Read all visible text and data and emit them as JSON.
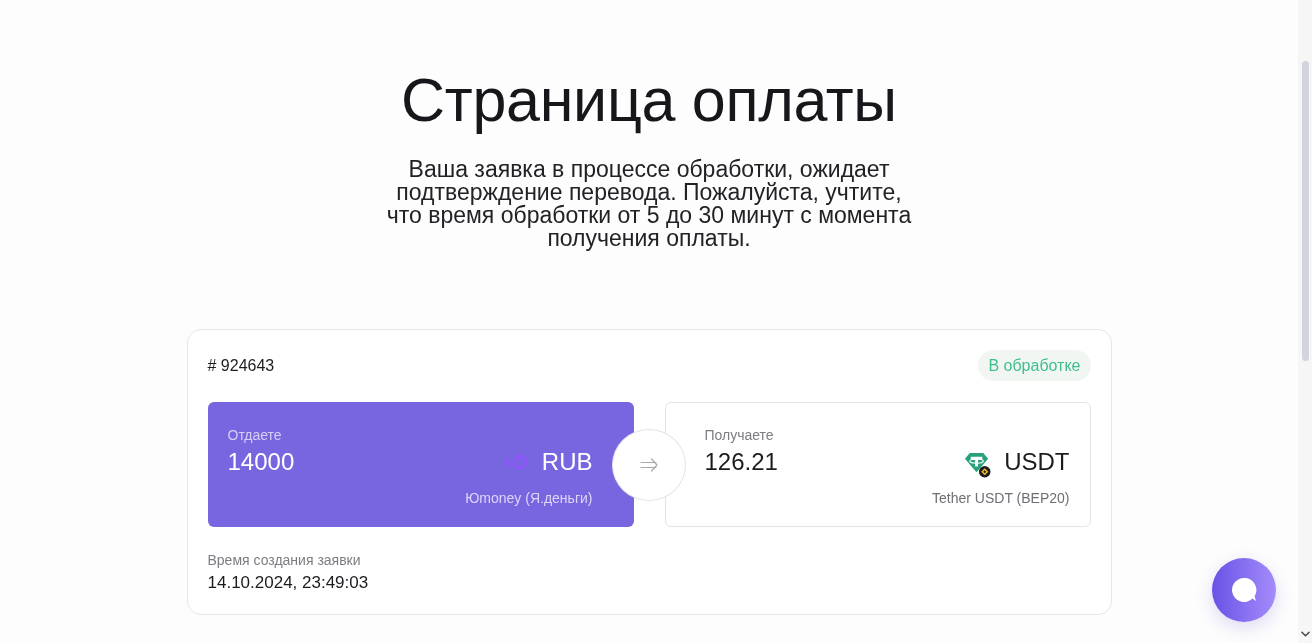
{
  "page": {
    "title": "Страница оплаты",
    "description": "Ваша заявка в процессе обработки, ожидает подтверждение перевода. Пожалуйста, учтите, что время обработки от 5 до 30 минут с момента получения оплаты."
  },
  "order": {
    "number": "# 924643",
    "status": {
      "label": "В обработке",
      "kind": "processing"
    }
  },
  "exchange": {
    "give": {
      "label": "Отдаете",
      "amount": "14000",
      "currency": "RUB",
      "method": "Юmoney (Я.деньги)"
    },
    "receive": {
      "label": "Получаете",
      "amount": "126.21",
      "currency": "USDT",
      "method": "Tether USDT (BEP20)"
    }
  },
  "created": {
    "label": "Время создания заявки",
    "value": "14.10.2024, 23:49:03"
  }
}
